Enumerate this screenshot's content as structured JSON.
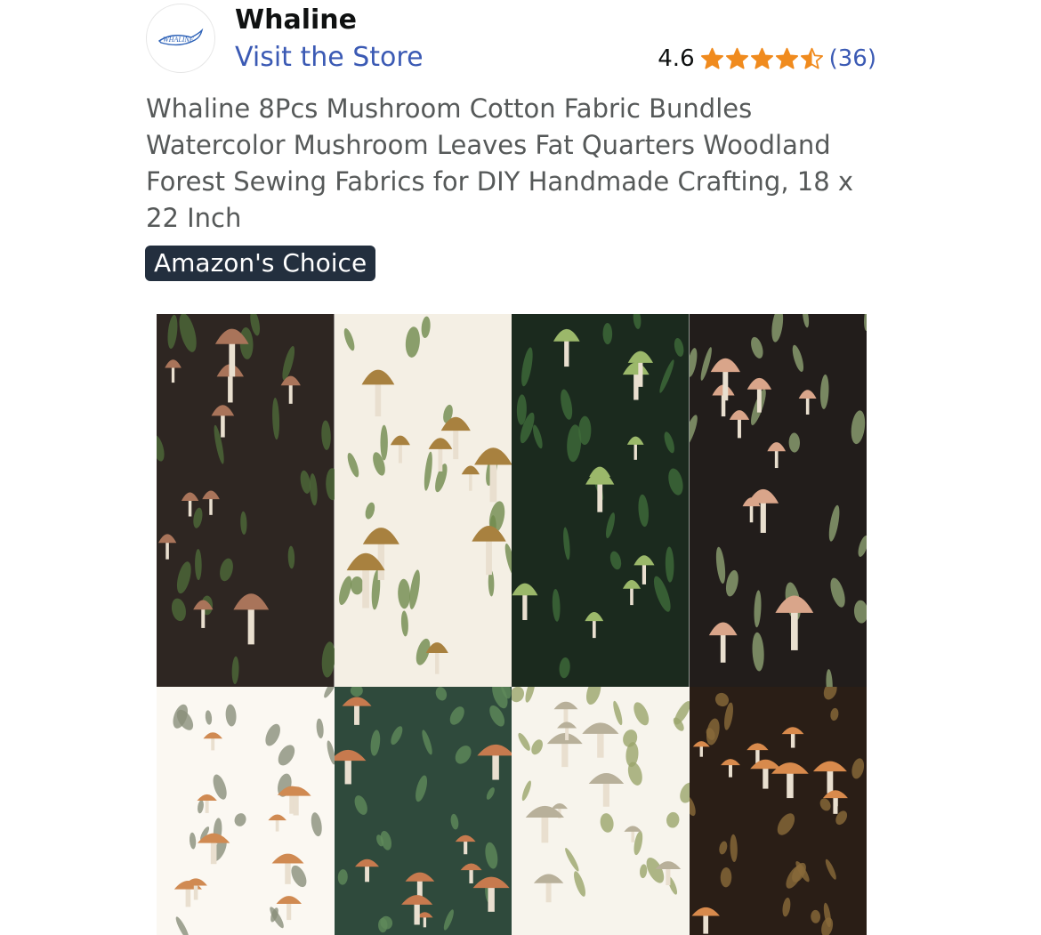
{
  "store": {
    "name": "Whaline",
    "logo_text": "WHALINE",
    "link_label": "Visit the Store"
  },
  "rating": {
    "value": "4.6",
    "stars": 4.5,
    "count": "(36)",
    "star_color": "#f08b1e"
  },
  "product": {
    "title": "Whaline 8Pcs Mushroom Cotton Fabric Bundles Watercolor Mushroom Leaves Fat Quarters Woodland Forest Sewing Fabrics for DIY Handmade Crafting, 18 x 22 Inch"
  },
  "badge": {
    "label": "Amazon's Choice"
  },
  "gallery": {
    "swatches": [
      {
        "name": "dark-brown-mushroom-print",
        "bg": "#2e2622",
        "cap": "#a9745a",
        "leaf": "#4d6a3a"
      },
      {
        "name": "cream-brown-mushroom-print",
        "bg": "#f4efe4",
        "cap": "#a8813f",
        "leaf": "#6f8a4c"
      },
      {
        "name": "green-forest-mushroom-print",
        "bg": "#1b2a1e",
        "cap": "#9bb86a",
        "leaf": "#3f6b3a"
      },
      {
        "name": "black-tan-mushroom-print",
        "bg": "#221d1b",
        "cap": "#d9a58a",
        "leaf": "#8fa373"
      },
      {
        "name": "white-orange-mushroom-print",
        "bg": "#fbf8f2",
        "cap": "#d08a52",
        "leaf": "#8a8f7a"
      },
      {
        "name": "teal-green-mushroom-print",
        "bg": "#2f4a3c",
        "cap": "#c77a4e",
        "leaf": "#5f8a5a"
      },
      {
        "name": "white-sage-mushroom-print",
        "bg": "#f7f4ec",
        "cap": "#b8b09a",
        "leaf": "#9aa56c"
      },
      {
        "name": "chocolate-orange-mushroom-print",
        "bg": "#2a1e16",
        "cap": "#d88a4c",
        "leaf": "#8a6a3a"
      }
    ]
  }
}
